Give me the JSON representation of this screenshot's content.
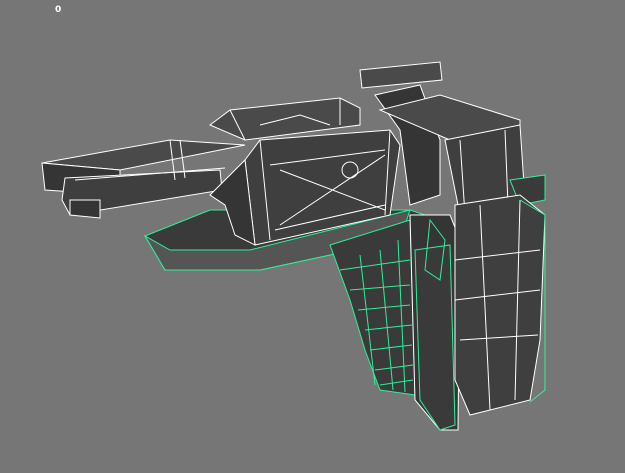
{
  "viewport": {
    "frame_counter": "0",
    "background_color": "#767676",
    "selection_color": "#2ef09a",
    "wire_color": "#ffffff"
  }
}
